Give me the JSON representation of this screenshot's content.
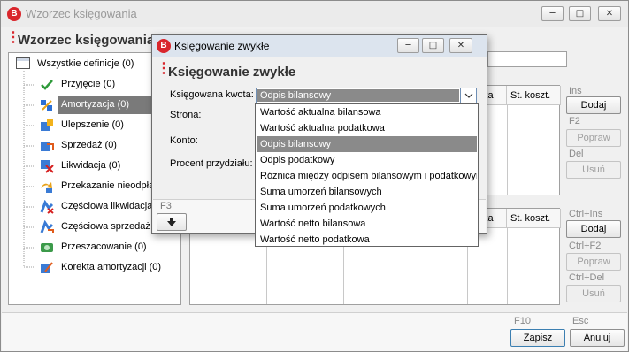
{
  "main": {
    "title": "Wzorzec księgowania",
    "section_title": "Wzorzec księgowania"
  },
  "tree": {
    "root": "Wszystkie definicje (0)",
    "items": [
      {
        "label": "Przyjęcie (0)",
        "icon": "green-check-icon"
      },
      {
        "label": "Amortyzacja (0)",
        "icon": "amortization-icon"
      },
      {
        "label": "Ulepszenie (0)",
        "icon": "upgrade-icon"
      },
      {
        "label": "Sprzedaż (0)",
        "icon": "sale-icon"
      },
      {
        "label": "Likwidacja (0)",
        "icon": "liquidation-icon"
      },
      {
        "label": "Przekazanie nieodpła",
        "icon": "transfer-icon"
      },
      {
        "label": "Częściowa likwidacja",
        "icon": "partial-liquidation-icon"
      },
      {
        "label": "Częściowa sprzedaż (",
        "icon": "partial-sale-icon"
      },
      {
        "label": "Przeszacowanie (0)",
        "icon": "revaluation-icon"
      },
      {
        "label": "Korekta amortyzacji (0)",
        "icon": "correction-icon"
      }
    ]
  },
  "grid_top": {
    "headers": [
      "ityka",
      "St. koszt."
    ]
  },
  "grid_bottom": {
    "headers": [
      "ityka",
      "St. koszt."
    ]
  },
  "buttons_top": {
    "add_shortcut": "Ins",
    "add": "Dodaj",
    "edit_shortcut": "F2",
    "edit": "Popraw",
    "delete_shortcut": "Del",
    "delete": "Usuń"
  },
  "buttons_bottom": {
    "add_shortcut": "Ctrl+Ins",
    "add": "Dodaj",
    "edit_shortcut": "Ctrl+F2",
    "edit": "Popraw",
    "delete_shortcut": "Ctrl+Del",
    "delete": "Usuń"
  },
  "footer": {
    "save_shortcut": "F10",
    "save": "Zapisz",
    "cancel_shortcut": "Esc",
    "cancel": "Anuluj"
  },
  "dialog": {
    "title": "Księgowanie zwykłe",
    "section_title": "Księgowanie zwykłe",
    "labels": {
      "amount": "Księgowana kwota:",
      "side": "Strona:",
      "account": "Konto:",
      "percent": "Procent przydziału:"
    },
    "amount_value": "Odpis bilansowy",
    "bottom_shortcut": "F3"
  },
  "dropdown": {
    "options": [
      "Wartość aktualna bilansowa",
      "Wartość aktualna podatkowa",
      "Odpis bilansowy",
      "Odpis podatkowy",
      "Różnica między odpisem bilansowym i podatkowym",
      "Suma umorzeń bilansowych",
      "Suma umorzeń podatkowych",
      "Wartość netto bilansowa",
      "Wartość netto podatkowa"
    ],
    "selected_index": 2
  },
  "colors": {
    "brand": "#d9262c",
    "selection": "#7a7a7a"
  }
}
